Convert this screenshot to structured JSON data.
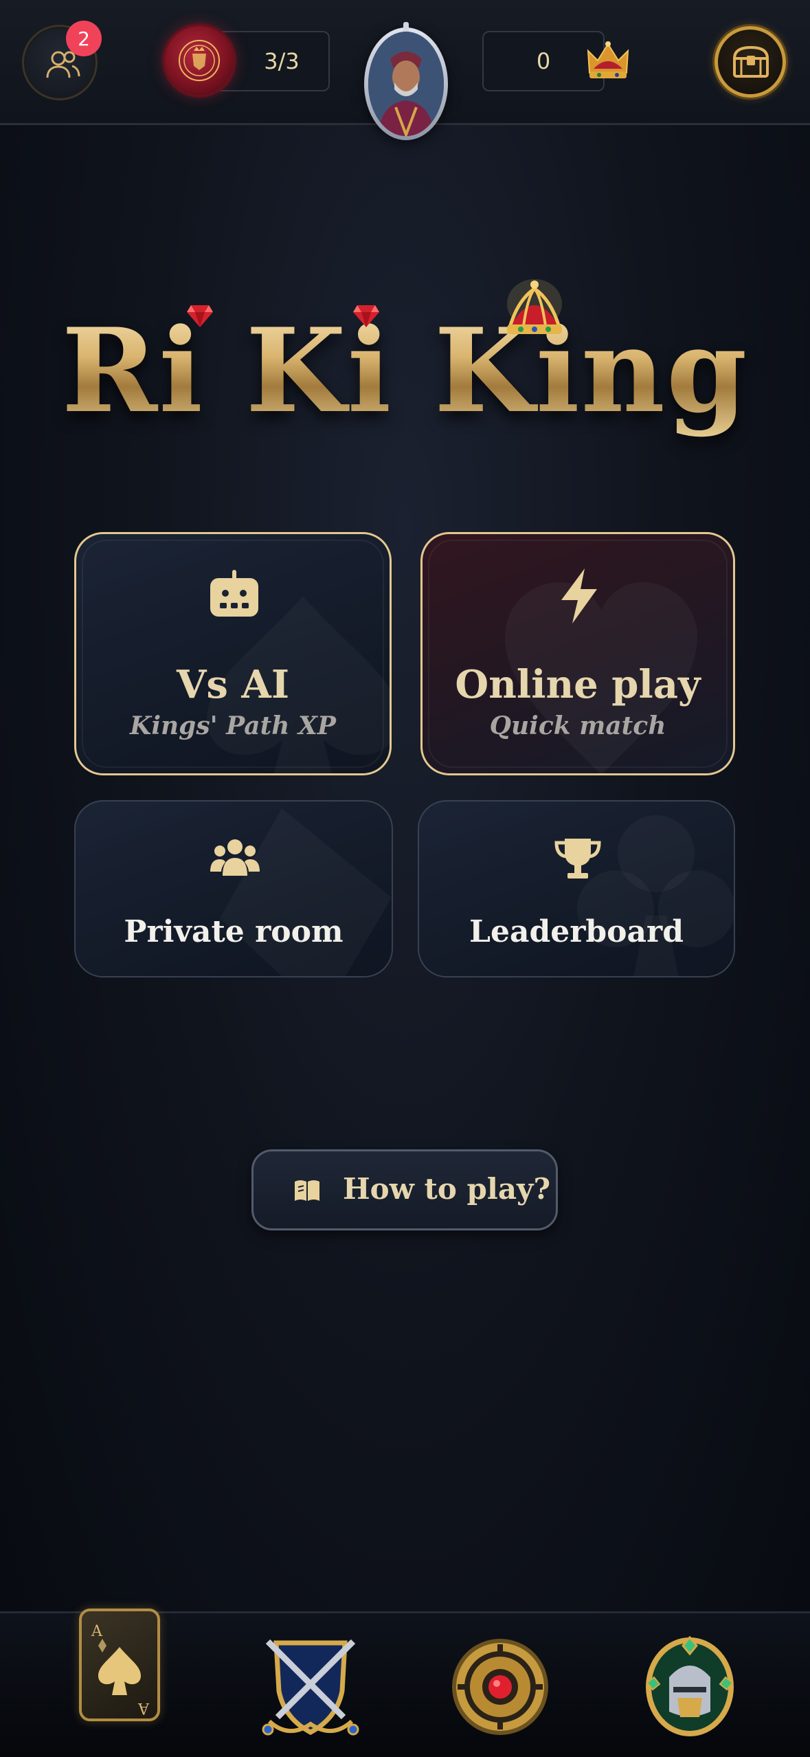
{
  "topbar": {
    "notification_count": "2",
    "lives": "3/3",
    "coins": "0",
    "icons": {
      "friends": "friends-icon",
      "seal": "royal-seal-icon",
      "avatar": "king-portrait",
      "coins": "crown-icon",
      "chest": "treasure-chest-icon"
    }
  },
  "logo": {
    "text": "Ri Ki King"
  },
  "modes": {
    "vs_ai": {
      "title": "Vs AI",
      "subtitle": "Kings' Path XP",
      "icon": "robot-icon"
    },
    "online": {
      "title": "Online play",
      "subtitle": "Quick match",
      "icon": "lightning-icon"
    },
    "private": {
      "title": "Private room",
      "icon": "group-icon"
    },
    "leaderboard": {
      "title": "Leaderboard",
      "icon": "trophy-icon"
    }
  },
  "how_to_play": {
    "label": "How to play?",
    "icon": "book-icon"
  },
  "bottom_nav": {
    "items": [
      {
        "name": "cards",
        "icon": "ace-of-spades-icon",
        "active": true
      },
      {
        "name": "battle",
        "icon": "crossed-swords-shield-icon",
        "active": false
      },
      {
        "name": "settings",
        "icon": "gear-gem-icon",
        "active": false
      },
      {
        "name": "profile",
        "icon": "knight-helmet-icon",
        "active": false
      }
    ],
    "card_rank": "A"
  },
  "colors": {
    "gold": "#e3c88f",
    "badge": "#f0435a",
    "background": "#10141d",
    "online_card": "#32161f"
  }
}
